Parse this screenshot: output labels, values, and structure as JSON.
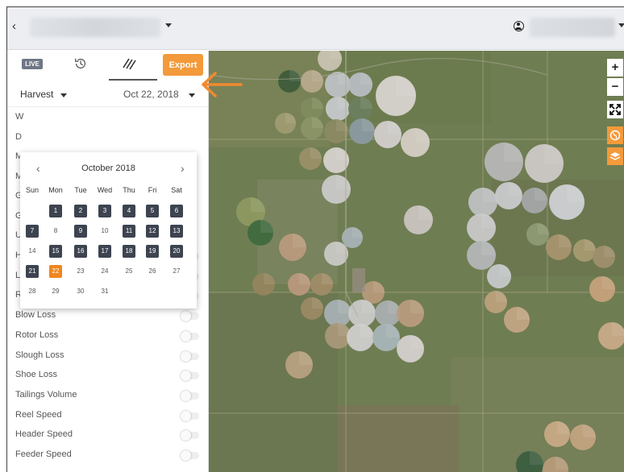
{
  "header": {
    "back_icon": "chevron-left-icon",
    "user_icon": "user-circle-icon"
  },
  "tabs": {
    "live_label": "LIVE",
    "export_label": "Export"
  },
  "selector": {
    "mode": "Harvest",
    "date": "Oct 22, 2018"
  },
  "calendar": {
    "title": "October 2018",
    "weekdays": [
      "Sun",
      "Mon",
      "Tue",
      "Wed",
      "Thu",
      "Fri",
      "Sat"
    ],
    "weeks": [
      [
        "",
        "1",
        "2",
        "3",
        "4",
        "5",
        "6"
      ],
      [
        "7",
        "8",
        "9",
        "10",
        "11",
        "12",
        "13"
      ],
      [
        "14",
        "15",
        "16",
        "17",
        "18",
        "19",
        "20"
      ],
      [
        "21",
        "22",
        "23",
        "24",
        "25",
        "26",
        "27"
      ],
      [
        "28",
        "29",
        "30",
        "31",
        "",
        "",
        ""
      ]
    ],
    "dark_days": [
      "1",
      "2",
      "3",
      "4",
      "5",
      "6",
      "7",
      "9",
      "11",
      "12",
      "13",
      "15",
      "16",
      "17",
      "18",
      "19",
      "20",
      "21"
    ],
    "selected_day": "22"
  },
  "layers": {
    "visible_letters": [
      "W",
      "D",
      "M",
      "M",
      "G",
      "G",
      "U"
    ],
    "items": [
      {
        "label": "Header Height"
      },
      {
        "label": "Left Loss"
      },
      {
        "label": "Right Loss"
      },
      {
        "label": "Blow Loss"
      },
      {
        "label": "Rotor Loss"
      },
      {
        "label": "Slough Loss"
      },
      {
        "label": "Shoe Loss"
      },
      {
        "label": "Tailings Volume"
      },
      {
        "label": "Reel Speed"
      },
      {
        "label": "Header Speed"
      },
      {
        "label": "Feeder Speed"
      }
    ]
  },
  "map_controls": {
    "zoom_in": "+",
    "zoom_out": "−",
    "fullscreen_icon": "expand-icon",
    "basemap_icon": "globe-icon",
    "layers_icon": "layers-icon"
  },
  "colors": {
    "accent": "#f39a3b",
    "selected": "#f0861e",
    "dark_day": "#3d4450",
    "annotation_arrow": "#f28a2e"
  }
}
